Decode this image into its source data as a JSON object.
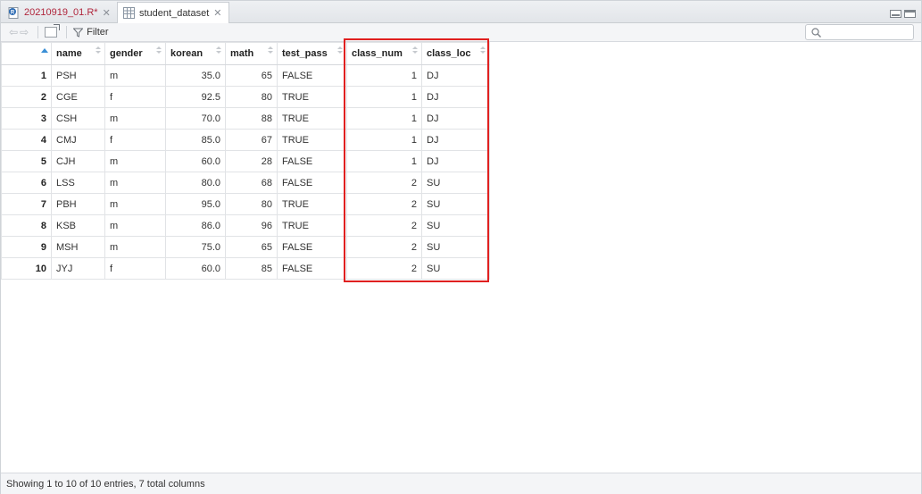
{
  "tabs": [
    {
      "label": "20210919_01.R*",
      "icon": "r-script-icon",
      "active": false
    },
    {
      "label": "student_dataset",
      "icon": "table-icon",
      "active": true
    }
  ],
  "toolbar": {
    "filter_label": "Filter",
    "search_placeholder": ""
  },
  "table": {
    "columns": [
      "name",
      "gender",
      "korean",
      "math",
      "test_pass",
      "class_num",
      "class_loc"
    ],
    "rows": [
      {
        "idx": "1",
        "cells": [
          "PSH",
          "m",
          "35.0",
          "65",
          "FALSE",
          "1",
          "DJ"
        ]
      },
      {
        "idx": "2",
        "cells": [
          "CGE",
          "f",
          "92.5",
          "80",
          "TRUE",
          "1",
          "DJ"
        ]
      },
      {
        "idx": "3",
        "cells": [
          "CSH",
          "m",
          "70.0",
          "88",
          "TRUE",
          "1",
          "DJ"
        ]
      },
      {
        "idx": "4",
        "cells": [
          "CMJ",
          "f",
          "85.0",
          "67",
          "TRUE",
          "1",
          "DJ"
        ]
      },
      {
        "idx": "5",
        "cells": [
          "CJH",
          "m",
          "60.0",
          "28",
          "FALSE",
          "1",
          "DJ"
        ]
      },
      {
        "idx": "6",
        "cells": [
          "LSS",
          "m",
          "80.0",
          "68",
          "FALSE",
          "2",
          "SU"
        ]
      },
      {
        "idx": "7",
        "cells": [
          "PBH",
          "m",
          "95.0",
          "80",
          "TRUE",
          "2",
          "SU"
        ]
      },
      {
        "idx": "8",
        "cells": [
          "KSB",
          "m",
          "86.0",
          "96",
          "TRUE",
          "2",
          "SU"
        ]
      },
      {
        "idx": "9",
        "cells": [
          "MSH",
          "m",
          "75.0",
          "65",
          "FALSE",
          "2",
          "SU"
        ]
      },
      {
        "idx": "10",
        "cells": [
          "JYJ",
          "f",
          "60.0",
          "85",
          "FALSE",
          "2",
          "SU"
        ]
      }
    ]
  },
  "highlight_color": "#e02020",
  "status": {
    "text": "Showing 1 to 10 of 10 entries, 7 total columns"
  }
}
